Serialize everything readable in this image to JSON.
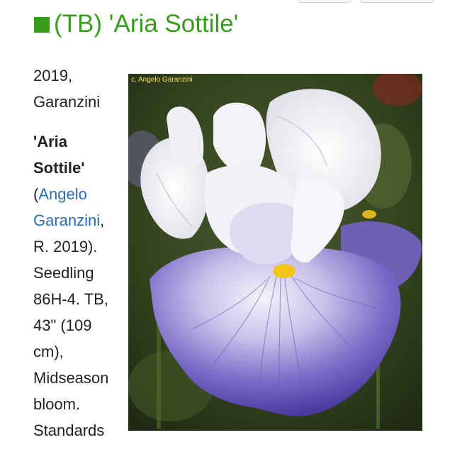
{
  "header": {
    "title": "(TB) 'Aria Sottile'"
  },
  "article": {
    "line_year": "2019,",
    "line_breeder": "Garanzini",
    "name_part1": "'Aria",
    "name_part2": "Sottile'",
    "open_paren": "(",
    "link_first": "Angelo",
    "link_last": "Garanzini",
    "comma": ",",
    "text_1": "R. 2019).",
    "text_2": "Seedling",
    "text_3": "86H-4. TB,",
    "text_4": "43\" (109",
    "text_5": "cm),",
    "text_6": "Midseason",
    "text_7": "bloom.",
    "text_8": "Standards"
  },
  "image": {
    "credit": "c. Angelo Garanzini",
    "alt": "Iris 'Aria Sottile' bloom"
  },
  "colors": {
    "title_green": "#3a9c1e",
    "link_blue": "#2a6db0",
    "credit_yellow": "#f2e24a"
  }
}
